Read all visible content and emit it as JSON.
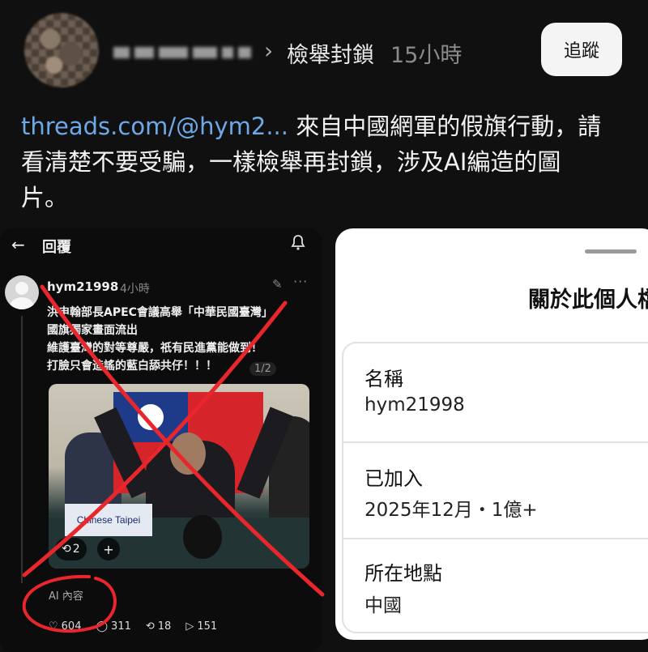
{
  "post": {
    "target_name": "檢舉封鎖",
    "time_ago": "15小時",
    "follow_label": "追蹤",
    "link_text": "threads.com/@hym2...",
    "text_line1": " 來自中國網軍的假旗行動，請",
    "text_line2": "看清楚不要受騙，一樣檢舉再封鎖，涉及AI編造的圖",
    "text_line3": "片。"
  },
  "screenshot_left": {
    "title": "回覆",
    "username": "hym21998",
    "time": "4小時",
    "body_line1": "洪申翰部長APEC會議高舉「中華民國臺灣」",
    "body_line2": "國旗獨家畫面流出",
    "body_line3": "維護臺灣的對等尊嚴，祇有民進黨能做到！",
    "body_line4": "打臉只會造謠的藍白舔共仔！！！",
    "page_indicator": "1/2",
    "nameplate": "Chinese Taipei",
    "repost_count_chip": "2",
    "ai_label": "AI 內容",
    "likes": "604",
    "comments": "311",
    "reposts": "18",
    "shares": "151"
  },
  "about_card": {
    "title": "關於此個人檔案",
    "name_label": "名稱",
    "name_value": "hym21998",
    "joined_label": "已加入",
    "joined_value": "2025年12月・1億+",
    "location_label": "所在地點",
    "location_value": "中國"
  },
  "colors": {
    "link": "#6fa8e8",
    "annotation_red": "#e8262b",
    "background": "#101010"
  },
  "icons": [
    "back-arrow-icon",
    "bell-icon",
    "pencil-icon",
    "more-icon",
    "heart-icon",
    "comment-icon",
    "repost-icon",
    "share-icon",
    "chevron-right-icon"
  ]
}
